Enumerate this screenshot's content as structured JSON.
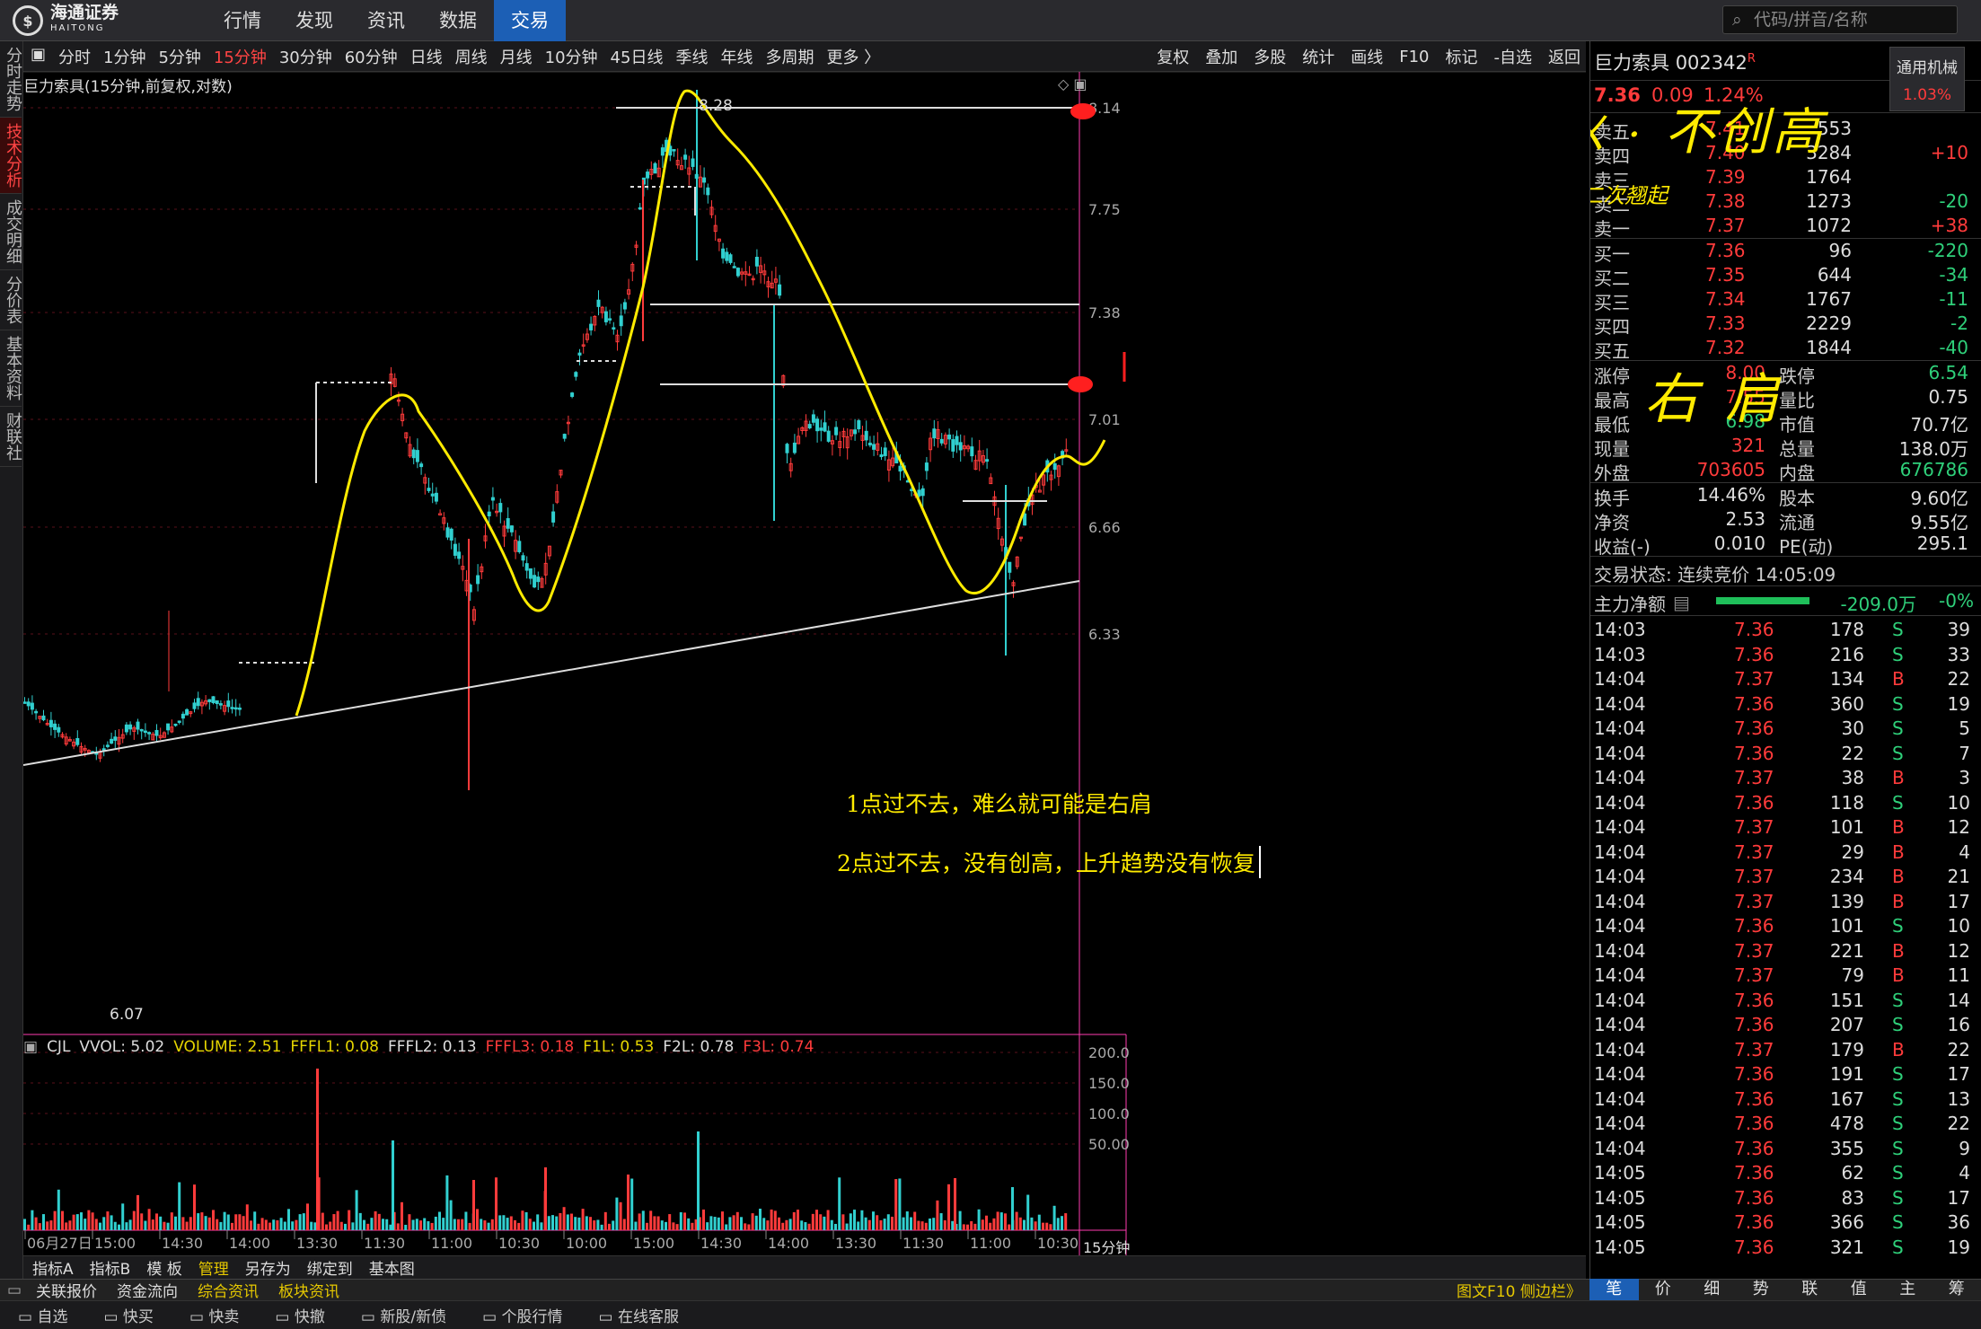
{
  "topbar": {
    "logo_name": "海通证券",
    "logo_sub": "HAITONG",
    "nav": [
      "行情",
      "发现",
      "资讯",
      "数据",
      "交易"
    ],
    "active_nav": "交易",
    "search_placeholder": "代码/拼音/名称"
  },
  "left_tabs": [
    "分时走势",
    "技术分析",
    "成交明细",
    "分价表",
    "基本资料",
    "财联社"
  ],
  "periods": [
    "分时",
    "1分钟",
    "5分钟",
    "15分钟",
    "30分钟",
    "60分钟",
    "日线",
    "周线",
    "月线",
    "10分钟",
    "45日线",
    "季线",
    "年线",
    "多周期",
    "更多 〉"
  ],
  "selected_period": "15分钟",
  "right_tools": [
    "复权",
    "叠加",
    "多股",
    "统计",
    "画线",
    "F10",
    "标记",
    "-自选",
    "返回"
  ],
  "chart_title": "巨力索具(15分钟,前复权,对数)",
  "price_axis": [
    "8.14",
    "7.75",
    "7.38",
    "7.01",
    "6.66",
    "6.33"
  ],
  "high_label": "8.28",
  "low_label": "6.07",
  "time_axis": [
    "06月27日",
    "15:00",
    "14:30",
    "14:00",
    "13:30",
    "11:30",
    "11:00",
    "10:30",
    "10:00",
    "15:00",
    "14:30",
    "14:00",
    "13:30",
    "11:30",
    "11:00",
    "10:30"
  ],
  "volume_axis": [
    "200.0",
    "150.0",
    "100.0",
    "50.00"
  ],
  "period_badge": "15分钟",
  "indicator": {
    "name": "CJL",
    "items": [
      {
        "label": "VVOL: 5.02",
        "color": "#dddddd"
      },
      {
        "label": "VOLUME: 2.51",
        "color": "#e6d600"
      },
      {
        "label": "FFFL1: 0.08",
        "color": "#e6d600"
      },
      {
        "label": "FFFL2: 0.13",
        "color": "#dddddd"
      },
      {
        "label": "FFFL3: 0.18",
        "color": "#ff3b3b"
      },
      {
        "label": "F1L: 0.53",
        "color": "#e6d600"
      },
      {
        "label": "F2L: 0.78",
        "color": "#dddddd"
      },
      {
        "label": "F3L: 0.74",
        "color": "#ff3b3b"
      }
    ]
  },
  "annotations": {
    "note1": "1点过不去，难么就可能是右肩",
    "note2": "2点过不去，没有创高，上升趋势没有恢复",
    "hand_top": "不创高",
    "hand_second": "二次翘起",
    "hand_right": "右肩"
  },
  "stock": {
    "name": "巨力索具",
    "code": "002342",
    "flag": "R",
    "price": "7.36",
    "change": "0.09",
    "pct": "1.24%",
    "sector": "通用机械",
    "sector_pct": "1.03%"
  },
  "sell_orders": [
    {
      "label": "卖五",
      "price": "7.41",
      "vol": "553",
      "diff": ""
    },
    {
      "label": "卖四",
      "price": "7.40",
      "vol": "3284",
      "diff": "+10"
    },
    {
      "label": "卖三",
      "price": "7.39",
      "vol": "1764",
      "diff": ""
    },
    {
      "label": "卖二",
      "price": "7.38",
      "vol": "1273",
      "diff": "-20"
    },
    {
      "label": "卖一",
      "price": "7.37",
      "vol": "1072",
      "diff": "+38"
    }
  ],
  "buy_orders": [
    {
      "label": "买一",
      "price": "7.36",
      "vol": "96",
      "diff": "-220"
    },
    {
      "label": "买二",
      "price": "7.35",
      "vol": "644",
      "diff": "-34"
    },
    {
      "label": "买三",
      "price": "7.34",
      "vol": "1767",
      "diff": "-11"
    },
    {
      "label": "买四",
      "price": "7.33",
      "vol": "2229",
      "diff": "-2"
    },
    {
      "label": "买五",
      "price": "7.32",
      "vol": "1844",
      "diff": "-40"
    }
  ],
  "stats": [
    {
      "l1": "涨停",
      "v1": "8.00",
      "l2": "跌停",
      "v2": "6.54",
      "c1": "r",
      "c2": "g"
    },
    {
      "l1": "最高",
      "v1": "7.55",
      "l2": "量比",
      "v2": "0.75",
      "c1": "r",
      "c2": "w"
    },
    {
      "l1": "最低",
      "v1": "6.98",
      "l2": "市值",
      "v2": "70.7亿",
      "c1": "g",
      "c2": "w"
    },
    {
      "l1": "现量",
      "v1": "321",
      "l2": "总量",
      "v2": "138.0万",
      "c1": "r",
      "c2": "w"
    },
    {
      "l1": "外盘",
      "v1": "703605",
      "l2": "内盘",
      "v2": "676786",
      "c1": "r",
      "c2": "g"
    }
  ],
  "fund": [
    {
      "l1": "换手",
      "v1": "14.46%",
      "l2": "股本",
      "v2": "9.60亿"
    },
    {
      "l1": "净资",
      "v1": "2.53",
      "l2": "流通",
      "v2": "9.55亿"
    },
    {
      "l1": "收益(-)",
      "v1": "0.010",
      "l2": "PE(动)",
      "v2": "295.1"
    }
  ],
  "trade_status": "交易状态: 连续竞价 14:05:09",
  "main_fund": {
    "label": "主力净额",
    "value": "-209.0万",
    "pct": "-0%"
  },
  "ticks": [
    [
      "14:03",
      "7.36",
      "178",
      "S",
      "39"
    ],
    [
      "14:03",
      "7.36",
      "216",
      "S",
      "33"
    ],
    [
      "14:04",
      "7.37",
      "134",
      "B",
      "22"
    ],
    [
      "14:04",
      "7.36",
      "360",
      "S",
      "19"
    ],
    [
      "14:04",
      "7.36",
      "30",
      "S",
      "5"
    ],
    [
      "14:04",
      "7.36",
      "22",
      "S",
      "7"
    ],
    [
      "14:04",
      "7.37",
      "38",
      "B",
      "3"
    ],
    [
      "14:04",
      "7.36",
      "118",
      "S",
      "10"
    ],
    [
      "14:04",
      "7.37",
      "101",
      "B",
      "12"
    ],
    [
      "14:04",
      "7.37",
      "29",
      "B",
      "4"
    ],
    [
      "14:04",
      "7.37",
      "234",
      "B",
      "21"
    ],
    [
      "14:04",
      "7.37",
      "139",
      "B",
      "17"
    ],
    [
      "14:04",
      "7.36",
      "101",
      "S",
      "10"
    ],
    [
      "14:04",
      "7.37",
      "221",
      "B",
      "12"
    ],
    [
      "14:04",
      "7.37",
      "79",
      "B",
      "11"
    ],
    [
      "14:04",
      "7.36",
      "151",
      "S",
      "14"
    ],
    [
      "14:04",
      "7.36",
      "207",
      "S",
      "16"
    ],
    [
      "14:04",
      "7.37",
      "179",
      "B",
      "22"
    ],
    [
      "14:04",
      "7.36",
      "191",
      "S",
      "17"
    ],
    [
      "14:04",
      "7.36",
      "167",
      "S",
      "13"
    ],
    [
      "14:04",
      "7.36",
      "478",
      "S",
      "22"
    ],
    [
      "14:04",
      "7.36",
      "355",
      "S",
      "9"
    ],
    [
      "14:05",
      "7.36",
      "62",
      "S",
      "4"
    ],
    [
      "14:05",
      "7.36",
      "83",
      "S",
      "17"
    ],
    [
      "14:05",
      "7.36",
      "366",
      "S",
      "36"
    ],
    [
      "14:05",
      "7.36",
      "321",
      "S",
      "19"
    ]
  ],
  "bottom_tabs": [
    "指标A",
    "指标B",
    "模 板",
    "管理",
    "另存为",
    "绑定到",
    "基本图"
  ],
  "status_items": [
    "关联报价",
    "资金流向",
    "综合资讯",
    "板块资讯"
  ],
  "status_right": "图文F10 侧边栏》",
  "right_tabs": [
    "笔",
    "价",
    "细",
    "势",
    "联",
    "值",
    "主",
    "筹"
  ],
  "taskbar": [
    "自选",
    "快买",
    "快卖",
    "快撤",
    "新股/新债",
    "个股行情",
    "在线客服"
  ]
}
